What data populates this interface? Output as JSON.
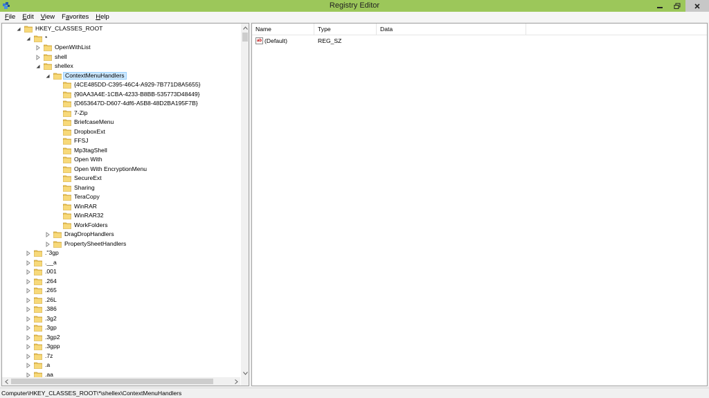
{
  "window": {
    "title": "Registry Editor",
    "accent": "#9cc75a",
    "icons": [
      "regedit-icon",
      "minimize-icon",
      "maximize-icon",
      "close-icon"
    ]
  },
  "menu": {
    "items": [
      {
        "accel": "F",
        "rest": "ile"
      },
      {
        "accel": "E",
        "rest": "dit"
      },
      {
        "accel": "V",
        "rest": "iew"
      },
      {
        "accel": "a",
        "pre": "F",
        "rest": "vorites"
      },
      {
        "accel": "H",
        "rest": "elp"
      }
    ]
  },
  "tree": {
    "items": [
      {
        "label": "HKEY_CLASSES_ROOT",
        "expanded": true
      },
      {
        "label": "*",
        "expanded": true
      },
      {
        "label": "OpenWithList",
        "expanded": false
      },
      {
        "label": "shell",
        "expanded": false
      },
      {
        "label": "shellex",
        "expanded": true
      },
      {
        "label": "ContextMenuHandlers",
        "expanded": true,
        "selected": true
      },
      {
        "label": "{4CE485DD-C395-46C4-A929-7B771D8A5655}"
      },
      {
        "label": "{90AA3A4E-1CBA-4233-B8BB-535773D48449}"
      },
      {
        "label": "{D653647D-D607-4df6-A5B8-48D2BA195F7B}"
      },
      {
        "label": "7-Zip"
      },
      {
        "label": "BriefcaseMenu"
      },
      {
        "label": "DropboxExt"
      },
      {
        "label": "FFSJ"
      },
      {
        "label": "Mp3tagShell"
      },
      {
        "label": "Open With"
      },
      {
        "label": "Open With EncryptionMenu"
      },
      {
        "label": "SecureExt"
      },
      {
        "label": "Sharing"
      },
      {
        "label": "TeraCopy"
      },
      {
        "label": "WinRAR"
      },
      {
        "label": "WinRAR32"
      },
      {
        "label": "WorkFolders"
      },
      {
        "label": "DragDropHandlers",
        "expanded": false
      },
      {
        "label": "PropertySheetHandlers",
        "expanded": false
      },
      {
        "label": ".\"3gp",
        "expanded": false
      },
      {
        "label": ".__a",
        "expanded": false
      },
      {
        "label": ".001",
        "expanded": false
      },
      {
        "label": ".264",
        "expanded": false
      },
      {
        "label": ".265",
        "expanded": false
      },
      {
        "label": ".26L",
        "expanded": false
      },
      {
        "label": ".386",
        "expanded": false
      },
      {
        "label": ".3g2",
        "expanded": false
      },
      {
        "label": ".3gp",
        "expanded": false
      },
      {
        "label": ".3gp2",
        "expanded": false
      },
      {
        "label": ".3gpp",
        "expanded": false
      },
      {
        "label": ".7z",
        "expanded": false
      },
      {
        "label": ".a",
        "expanded": false
      },
      {
        "label": ".aa",
        "expanded": false
      }
    ]
  },
  "list": {
    "columns": [
      "Name",
      "Type",
      "Data"
    ],
    "rows": [
      {
        "name": "(Default)",
        "type": "REG_SZ",
        "data": "",
        "icon_text": "ab"
      }
    ]
  },
  "status": {
    "path": "Computer\\HKEY_CLASSES_ROOT\\*\\shellex\\ContextMenuHandlers"
  }
}
